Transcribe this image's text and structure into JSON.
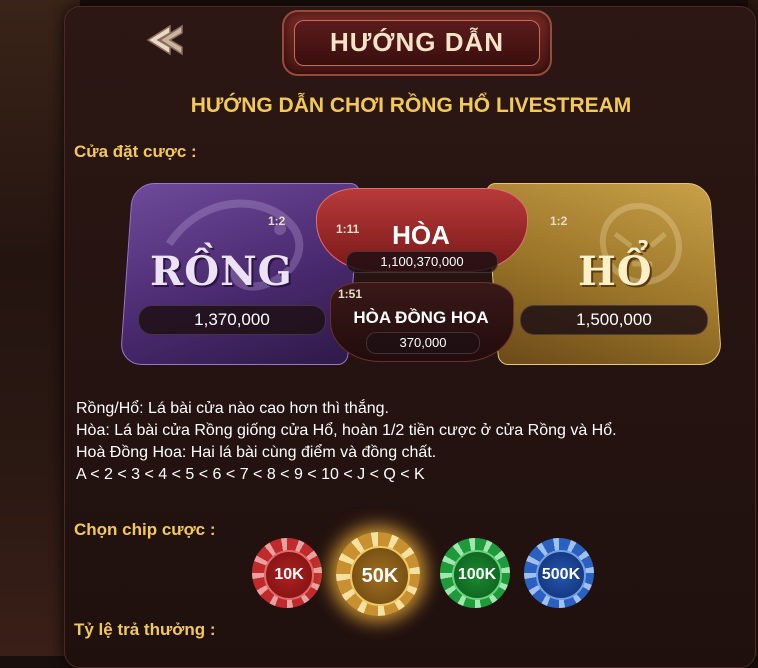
{
  "header": {
    "title": "HƯỚNG DẪN",
    "back_icon": "back-arrow-icon"
  },
  "guide": {
    "heading": "HƯỚNG DẪN CHƠI RỒNG HỔ LIVESTREAM",
    "bet_section_label": "Cửa đặt cược :",
    "chip_section_label": "Chọn chip cược :",
    "payout_section_label": "Tỷ lệ trả thưởng :"
  },
  "bets": {
    "dragon": {
      "name": "RỒNG",
      "ratio": "1:2",
      "amount": "1,370,000"
    },
    "tie": {
      "name": "HÒA",
      "ratio": "1:11",
      "amount": "1,100,370,000"
    },
    "suited_tie": {
      "name": "HÒA ĐỒNG HOA",
      "ratio": "1:51",
      "amount": "370,000"
    },
    "tiger": {
      "name": "HỔ",
      "ratio": "1:2",
      "amount": "1,500,000"
    }
  },
  "rules": [
    "Rồng/Hổ:  Lá bài cửa nào cao hơn thì thắng.",
    "Hòa: Lá bài cửa Rồng giống cửa Hổ, hoàn 1/2 tiền cược ở cửa Rồng và Hổ.",
    "Hoà Đồng Hoa: Hai lá bài cùng điểm và đồng chất.",
    "A < 2 < 3 < 4 < 5 < 6 < 7 < 8 < 9 < 10 < J < Q < K"
  ],
  "chips": [
    {
      "label": "10K",
      "color": "#c02a2a"
    },
    {
      "label": "50K",
      "color": "#c89030",
      "selected": true
    },
    {
      "label": "100K",
      "color": "#1f9a3a"
    },
    {
      "label": "500K",
      "color": "#2a60c0"
    }
  ],
  "colors": {
    "accent_gold": "#f2c955",
    "title_text": "#f6e3c8"
  }
}
